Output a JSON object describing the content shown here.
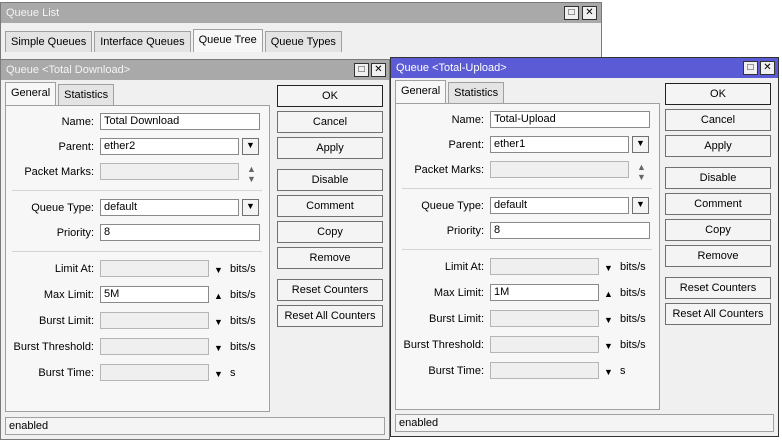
{
  "queue_list": {
    "title": "Queue List",
    "tabs": [
      "Simple Queues",
      "Interface Queues",
      "Queue Tree",
      "Queue Types"
    ]
  },
  "download": {
    "title": "Queue <Total Download>",
    "tabs": [
      "General",
      "Statistics"
    ],
    "labels": {
      "name": "Name:",
      "parent": "Parent:",
      "packet_marks": "Packet Marks:",
      "queue_type": "Queue Type:",
      "priority": "Priority:",
      "limit_at": "Limit At:",
      "max_limit": "Max Limit:",
      "burst_limit": "Burst Limit:",
      "burst_threshold": "Burst Threshold:",
      "burst_time": "Burst Time:"
    },
    "values": {
      "name": "Total Download",
      "parent": "ether2",
      "packet_marks": "",
      "queue_type": "default",
      "priority": "8",
      "limit_at": "",
      "max_limit": "5M",
      "burst_limit": "",
      "burst_threshold": "",
      "burst_time": ""
    },
    "units": {
      "bits": "bits/s",
      "seconds": "s"
    },
    "buttons": [
      "OK",
      "Cancel",
      "Apply",
      "Disable",
      "Comment",
      "Copy",
      "Remove",
      "Reset Counters",
      "Reset All Counters"
    ],
    "status": "enabled"
  },
  "upload": {
    "title": "Queue <Total-Upload>",
    "tabs": [
      "General",
      "Statistics"
    ],
    "labels": {
      "name": "Name:",
      "parent": "Parent:",
      "packet_marks": "Packet Marks:",
      "queue_type": "Queue Type:",
      "priority": "Priority:",
      "limit_at": "Limit At:",
      "max_limit": "Max Limit:",
      "burst_limit": "Burst Limit:",
      "burst_threshold": "Burst Threshold:",
      "burst_time": "Burst Time:"
    },
    "values": {
      "name": "Total-Upload",
      "parent": "ether1",
      "packet_marks": "",
      "queue_type": "default",
      "priority": "8",
      "limit_at": "",
      "max_limit": "1M",
      "burst_limit": "",
      "burst_threshold": "",
      "burst_time": ""
    },
    "units": {
      "bits": "bits/s",
      "seconds": "s"
    },
    "buttons": [
      "OK",
      "Cancel",
      "Apply",
      "Disable",
      "Comment",
      "Copy",
      "Remove",
      "Reset Counters",
      "Reset All Counters"
    ],
    "status": "enabled"
  },
  "icons": {
    "maximize": "maximize-icon",
    "close": "close-icon",
    "dropdown": "dropdown-arrow-icon",
    "up_down": "up-down-arrow-icon",
    "down": "down-arrow-icon",
    "up": "up-arrow-icon"
  },
  "colors": {
    "active_title": "#5b5bd6",
    "inactive_title": "#a9a9a9"
  }
}
